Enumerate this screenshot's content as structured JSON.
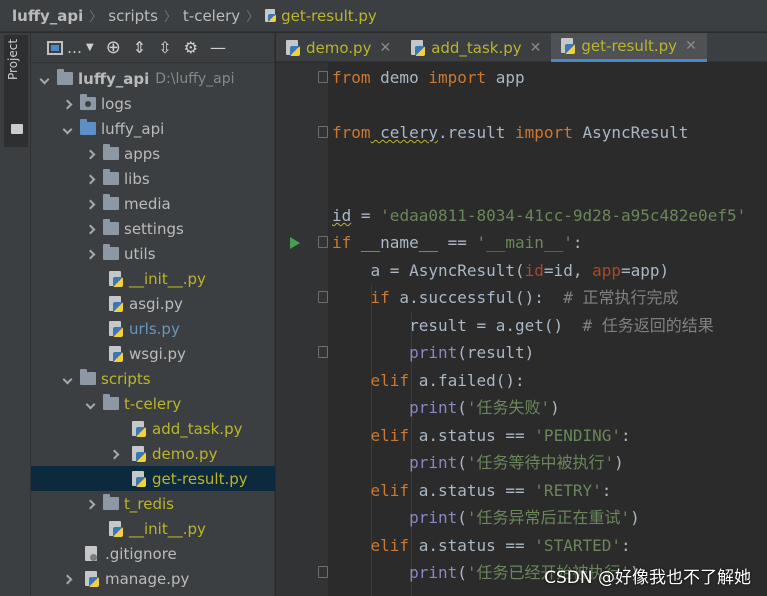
{
  "breadcrumb": {
    "items": [
      "luffy_api",
      "scripts",
      "t-celery",
      "get-result.py"
    ]
  },
  "toolstrip": {
    "project_label": "Project"
  },
  "project_toolbar": {
    "view_label": "…"
  },
  "tree": {
    "root_name": "luffy_api",
    "root_path": "D:\\luffy_api",
    "logs": "logs",
    "luffy_api": "luffy_api",
    "apps": "apps",
    "libs": "libs",
    "media": "media",
    "settings": "settings",
    "utils": "utils",
    "init1": "__init__.py",
    "asgi": "asgi.py",
    "urls": "urls.py",
    "wsgi": "wsgi.py",
    "scripts": "scripts",
    "tcelery": "t-celery",
    "addtask": "add_task.py",
    "demo": "demo.py",
    "getresult": "get-result.py",
    "tredis": "t_redis",
    "init2": "__init__.py",
    "gitignore": ".gitignore",
    "manage": "manage.py"
  },
  "tabs": [
    {
      "label": "demo.py",
      "close": "✕"
    },
    {
      "label": "add_task.py",
      "close": "✕"
    },
    {
      "label": "get-result.py",
      "close": "✕"
    }
  ],
  "code": {
    "l1_a": "from",
    "l1_b": " demo ",
    "l1_c": "import",
    "l1_d": " app",
    "l3_a": "from",
    "l3_b": " celery",
    "l3_c": ".result ",
    "l3_d": "import",
    "l3_e": " AsyncResult",
    "l6_a": "id",
    "l6_b": " = ",
    "l6_c": "'edaa0811-8034-41cc-9d28-a95c482e0ef5'",
    "l7_a": "if",
    "l7_b": " __name__ == ",
    "l7_c": "'__main__'",
    "l7_d": ":",
    "l8_a": "    a = AsyncResult(",
    "l8_b": "id",
    "l8_c": "=id, ",
    "l8_d": "app",
    "l8_e": "=app)",
    "l9_a": "    ",
    "l9_b": "if",
    "l9_c": " a.successful():  ",
    "l9_d": "# 正常执行完成",
    "l10_a": "        result = a.get()  ",
    "l10_b": "# 任务返回的结果",
    "l11_a": "        ",
    "l11_b": "print",
    "l11_c": "(result)",
    "l12_a": "    ",
    "l12_b": "elif",
    "l12_c": " a.failed():",
    "l13_a": "        ",
    "l13_b": "print",
    "l13_c": "(",
    "l13_d": "'任务失败'",
    "l13_e": ")",
    "l14_a": "    ",
    "l14_b": "elif",
    "l14_c": " a.status == ",
    "l14_d": "'PENDING'",
    "l14_e": ":",
    "l15_a": "        ",
    "l15_b": "print",
    "l15_c": "(",
    "l15_d": "'任务等待中被执行'",
    "l15_e": ")",
    "l16_a": "    ",
    "l16_b": "elif",
    "l16_c": " a.status == ",
    "l16_d": "'RETRY'",
    "l16_e": ":",
    "l17_a": "        ",
    "l17_b": "print",
    "l17_c": "(",
    "l17_d": "'任务异常后正在重试'",
    "l17_e": ")",
    "l18_a": "    ",
    "l18_b": "elif",
    "l18_c": " a.status == ",
    "l18_d": "'STARTED'",
    "l18_e": ":",
    "l19_a": "        ",
    "l19_b": "print",
    "l19_c": "(",
    "l19_d": "'任务已经开始被执行'",
    "l19_e": ")"
  },
  "watermark": "CSDN @好像我也不了解她",
  "colors": {
    "keyword": "#cc7832",
    "string": "#6a8759",
    "comment": "#808080",
    "builtin": "#8888c6",
    "selection": "#0d293e",
    "accent": "#4a88c7"
  }
}
